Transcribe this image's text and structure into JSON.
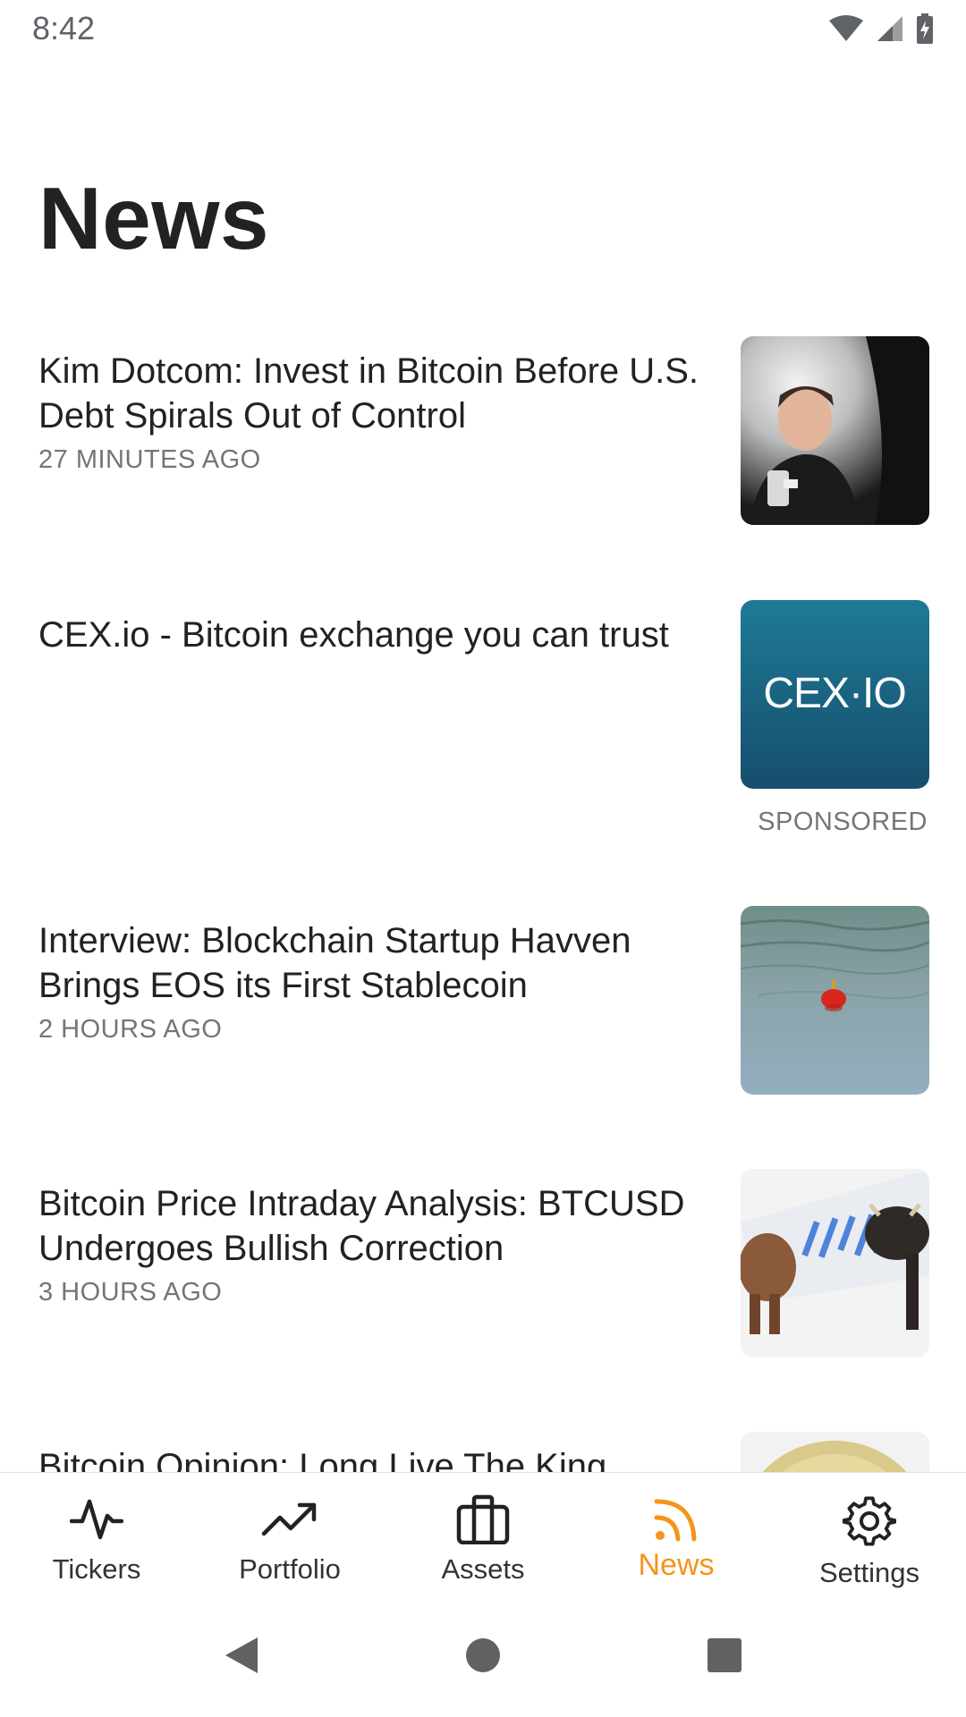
{
  "status_bar": {
    "time": "8:42",
    "icons": [
      "wifi-icon",
      "cell-signal-icon",
      "battery-charging-icon"
    ]
  },
  "page": {
    "title": "News"
  },
  "feed": {
    "items": [
      {
        "headline": "Kim Dotcom: Invest in Bitcoin Before U.S. Debt Spirals Out of Control",
        "timestamp": "27 MINUTES AGO",
        "image": "man-portrait-photo"
      },
      {
        "headline": "CEX.io - Bitcoin exchange you can trust",
        "timestamp": "",
        "image": "cex-io-logo",
        "logo_text": "CEX·IO",
        "sponsored_label": "SPONSORED"
      },
      {
        "headline": "Interview: Blockchain Startup Havven Brings EOS its First Stablecoin",
        "timestamp": "2 HOURS AGO",
        "image": "fishing-bobber-water-photo"
      },
      {
        "headline": "Bitcoin Price Intraday Analysis: BTCUSD Undergoes Bullish Correction",
        "timestamp": "3 HOURS AGO",
        "image": "bull-and-bear-photo"
      },
      {
        "headline": "Bitcoin Opinion: Long Live The King",
        "timestamp": "",
        "image": "coin-photo"
      }
    ]
  },
  "bottom_nav": {
    "tabs": [
      {
        "label": "Tickers",
        "icon": "pulse-icon",
        "active": false
      },
      {
        "label": "Portfolio",
        "icon": "trending-up-icon",
        "active": false
      },
      {
        "label": "Assets",
        "icon": "briefcase-icon",
        "active": false
      },
      {
        "label": "News",
        "icon": "rss-icon",
        "active": true
      },
      {
        "label": "Settings",
        "icon": "gear-icon",
        "active": false
      }
    ]
  },
  "system_nav": {
    "buttons": [
      "back-icon",
      "home-icon",
      "recents-icon"
    ]
  },
  "colors": {
    "accent": "#f7931a",
    "text_primary": "#222222",
    "text_secondary": "#757575",
    "cex_teal": "#1a6d8a",
    "cex_logo_accent": "#2ee6d6"
  }
}
